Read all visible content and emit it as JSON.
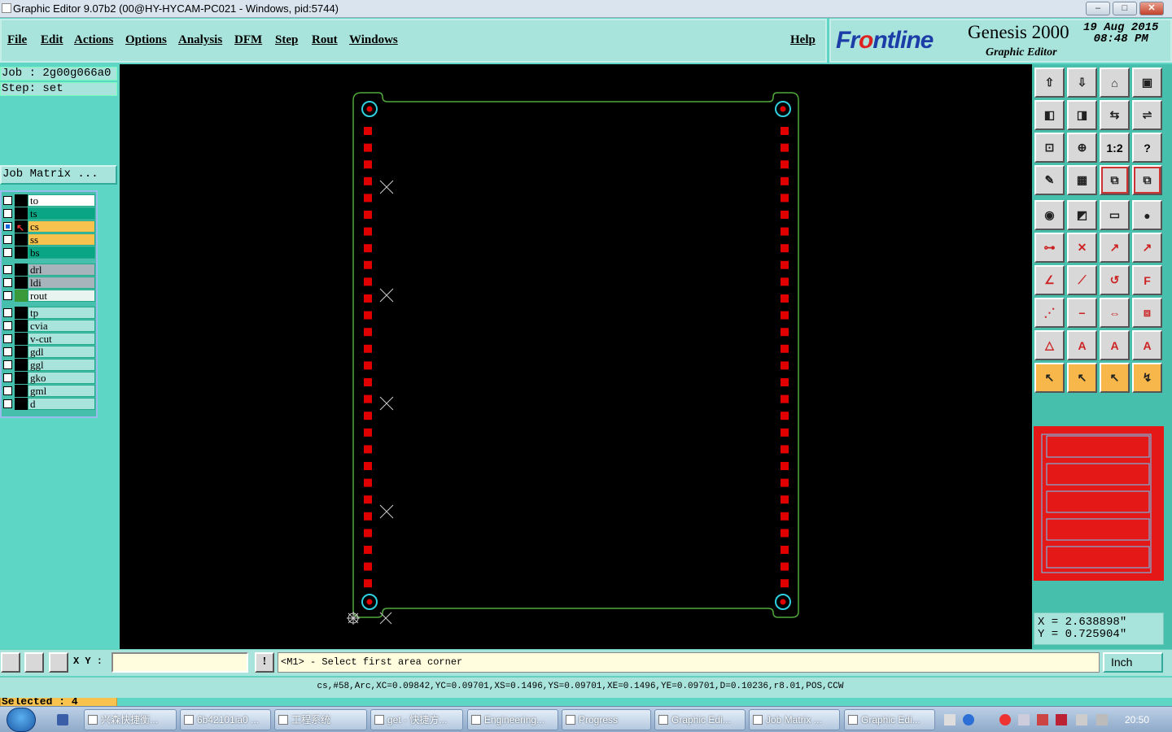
{
  "window": {
    "title": "Graphic Editor 9.07b2 (00@HY-HYCAM-PC021 - Windows, pid:5744)"
  },
  "menu": {
    "items": [
      "File",
      "Edit",
      "Actions",
      "Options",
      "Analysis",
      "DFM",
      "Step",
      "Rout",
      "Windows"
    ],
    "help": "Help"
  },
  "brand": {
    "logo_a": "Fr",
    "logo_b": "o",
    "logo_c": "ntline",
    "product": "Genesis 2000",
    "subtitle": "Graphic Editor",
    "date": "19 Aug 2015",
    "time": "08:48 PM"
  },
  "job": {
    "job_line": "Job : 2g00g066a0",
    "step_line": "Step: set",
    "matrix_button": "Job Matrix ..."
  },
  "layers": [
    {
      "name": "to",
      "color": "#ffffff",
      "checked": false
    },
    {
      "name": "ts",
      "color": "#0aa585",
      "checked": false
    },
    {
      "name": "cs",
      "color": "#f7c24e",
      "checked": true
    },
    {
      "name": "ss",
      "color": "#f7c24e",
      "checked": false
    },
    {
      "name": "bs",
      "color": "#0aa585",
      "checked": false
    },
    {
      "name": "drl",
      "color": "#a8b4bb",
      "checked": false
    },
    {
      "name": "ldi",
      "color": "#a8b4bb",
      "checked": false
    },
    {
      "name": "rout",
      "color": "#e8f4f0",
      "checked": false
    },
    {
      "name": "tp",
      "color": "#a9e4dc",
      "checked": false
    },
    {
      "name": "cvia",
      "color": "#a9e4dc",
      "checked": false
    },
    {
      "name": "v-cut",
      "color": "#a9e4dc",
      "checked": false
    },
    {
      "name": "gdl",
      "color": "#a9e4dc",
      "checked": false
    },
    {
      "name": "ggl",
      "color": "#a9e4dc",
      "checked": false
    },
    {
      "name": "gko",
      "color": "#a9e4dc",
      "checked": false
    },
    {
      "name": "gml",
      "color": "#a9e4dc",
      "checked": false
    },
    {
      "name": "d",
      "color": "#a9e4dc",
      "checked": false
    }
  ],
  "selected": "Selected : 4",
  "toolbar_labels": {
    "ratio": "1:2",
    "help": "?"
  },
  "coords": {
    "x": "X = 2.638898\"",
    "y": "Y = 0.725904\""
  },
  "input": {
    "xy_label": "X Y :",
    "xy_value": "",
    "exclaim": "!",
    "prompt": "<M1> - Select first area corner",
    "unit": "Inch"
  },
  "status": "cs,#58,Arc,XC=0.09842,YC=0.09701,XS=0.1496,YS=0.09701,XE=0.1496,YE=0.09701,D=0.10236,r8.01,POS,CCW",
  "taskbar": {
    "items": [
      "兴森快捷衡...",
      "6b42101ia0 ...",
      "工程系统",
      "get - 快捷方...",
      "Engineering...",
      "Progress",
      "Graphic Edi...",
      "Job Matrix ...",
      "Graphic Edi..."
    ],
    "clock": "20:50"
  },
  "colors": {
    "panel": "#5ed6c6",
    "board_outline": "#4fa83a",
    "pad": "#e00000",
    "fiducial": "#2fd0e0"
  }
}
